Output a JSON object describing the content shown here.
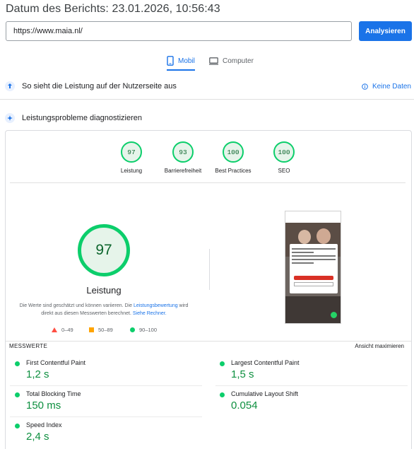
{
  "report": {
    "title": "Datum des Berichts: 23.01.2026, 10:56:43"
  },
  "search": {
    "url_value": "https://www.maia.nl/",
    "analyze_label": "Analysieren"
  },
  "device_tabs": {
    "mobile": "Mobil",
    "desktop": "Computer",
    "selected": "mobile"
  },
  "user_experience": {
    "title": "So sieht die Leistung auf der Nutzerseite aus",
    "no_data": "Keine Daten"
  },
  "diagnostics": {
    "title": "Leistungsprobleme diagnostizieren"
  },
  "categories": [
    {
      "score": "97",
      "label": "Leistung"
    },
    {
      "score": "93",
      "label": "Barrierefreiheit"
    },
    {
      "score": "100",
      "label": "Best Practices"
    },
    {
      "score": "100",
      "label": "SEO"
    }
  ],
  "performance": {
    "score": "97",
    "label": "Leistung",
    "desc_part1": "Die Werte sind geschätzt und können variieren. Die ",
    "desc_link1": "Leistungsbewertung",
    "desc_part2": " wird direkt aus diesen Messwerten berechnet. ",
    "desc_link2": "Siehe Rechner."
  },
  "legend": {
    "fail": "0–49",
    "average": "50–89",
    "pass": "90–100"
  },
  "metrics_section": {
    "title": "MESSWERTE",
    "expand_label": "Ansicht maximieren"
  },
  "metrics": [
    {
      "name": "First Contentful Paint",
      "value": "1,2 s"
    },
    {
      "name": "Largest Contentful Paint",
      "value": "1,5 s"
    },
    {
      "name": "Total Blocking Time",
      "value": "150 ms"
    },
    {
      "name": "Cumulative Layout Shift",
      "value": "0.054"
    },
    {
      "name": "Speed Index",
      "value": "2,4 s"
    }
  ],
  "colors": {
    "accent": "#1a73e8",
    "pass": "#0cce6b",
    "average": "#ffa400",
    "fail": "#ff4e42"
  }
}
